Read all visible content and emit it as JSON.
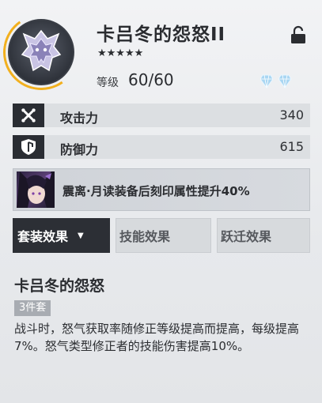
{
  "item": {
    "title": "卡吕冬的怨怒II",
    "stars": "★★★★★",
    "level_label": "等级",
    "level_value": "60/60"
  },
  "stats": [
    {
      "label": "攻击力",
      "value": "340",
      "icon": "attack-icon"
    },
    {
      "label": "防御力",
      "value": "615",
      "icon": "defense-icon"
    }
  ],
  "bonus": {
    "text": "震离·月读装备后刻印属性提升40%"
  },
  "tabs": {
    "set": "套装效果",
    "skill": "技能效果",
    "leap": "跃迁效果"
  },
  "set": {
    "title": "卡吕冬的怨怒",
    "badge": "3件套",
    "description": "战斗时，怒气获取率随修正等级提高而提高，每级提高7%。怒气类型修正者的技能伤害提高10%。"
  },
  "colors": {
    "accent_gold": "#f2b01e",
    "gem_blue": "#9fd0ee",
    "active_tab": "#2c2f35"
  }
}
